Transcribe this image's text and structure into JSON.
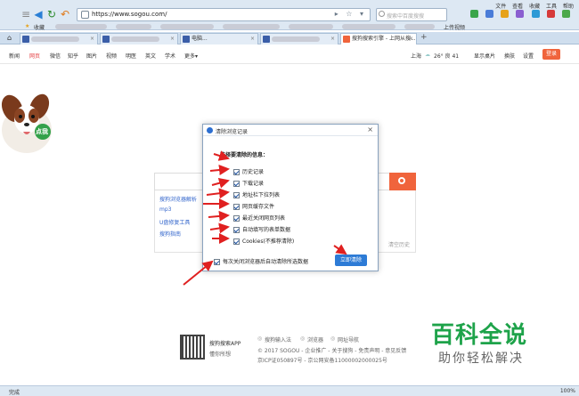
{
  "browser": {
    "url": "https://www.sogou.com/",
    "search_placeholder": "搜索中百度搜搜",
    "top_menu": [
      "文件",
      "查看",
      "收藏",
      "工具",
      "帮助"
    ],
    "status_left": "完成",
    "status_zoom": "100%"
  },
  "bookmarks": {
    "fav_label": "收藏",
    "item_label": "上传视频"
  },
  "tabs": [
    {
      "label": ""
    },
    {
      "label": ""
    },
    {
      "label": "电脑..."
    },
    {
      "label": ""
    },
    {
      "label": "搜狗搜索引擎 - 上网从搜..."
    }
  ],
  "page_nav": {
    "items": [
      "新闻",
      "网页",
      "微信",
      "知乎",
      "图片",
      "视频",
      "明医",
      "英文",
      "学术",
      "更多▾"
    ],
    "city": "上海",
    "weather": "26° 良 41",
    "show_desktop": "显示桌片",
    "skin": "换肤",
    "settings": "设置",
    "login": "登录"
  },
  "logo": {
    "badge": "点我"
  },
  "suggestions": [
    "搜狗浏览器解析",
    "mp3",
    "U盘修复工具",
    "搜狗指南"
  ],
  "clear_history": "清空历史",
  "dialog": {
    "title": "清除浏览记录",
    "header": "选择要清除的信息：",
    "options": [
      "历史记录",
      "下载记录",
      "地址栏下拉列表",
      "网页缓存文件",
      "最近关闭网页列表",
      "自动填写的表单数据",
      "Cookies(不推荐清除)"
    ],
    "auto_clear": "每次关闭浏览器后自动清除所选数据",
    "clear_button": "立即清除"
  },
  "footer": {
    "app_name": "搜狗搜索APP",
    "app_sub": "懂你所想",
    "links": [
      "搜狗输入法",
      "浏览器",
      "网址导航"
    ],
    "copyright": "© 2017 SOGOU - 企业推广 - 关于搜狗 - 免责声明 - 意见反馈",
    "icp": "京ICP证050897号 - 京公网安备11000002000025号"
  },
  "watermark": {
    "main": "百科全说",
    "sub": "助你轻松解决"
  },
  "colors": {
    "accent_orange": "#f0643c",
    "dialog_button": "#2d7bd6",
    "watermark_green": "#1ea34a",
    "arrow_red": "#e02020"
  }
}
